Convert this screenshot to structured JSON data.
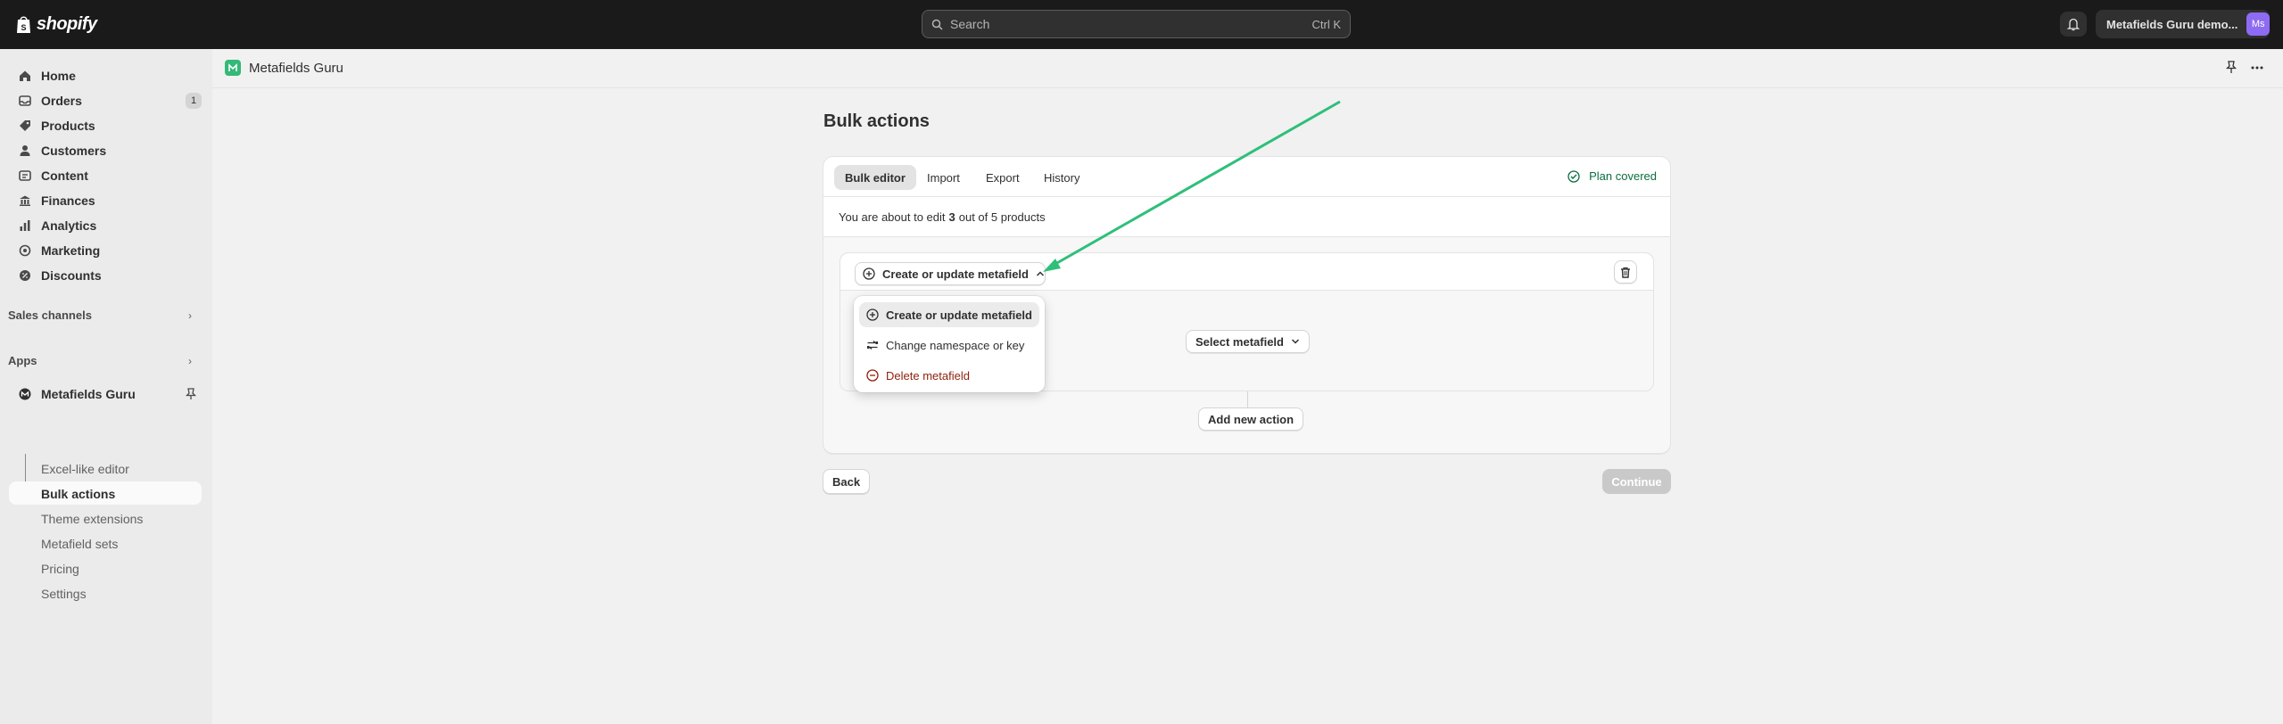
{
  "topbar": {
    "logo_text": "shopify",
    "search_placeholder": "Search",
    "search_shortcut": "Ctrl K",
    "store_name": "Metafields Guru demo...",
    "avatar_initials": "Ms"
  },
  "sidebar": {
    "items": [
      {
        "label": "Home",
        "icon": "home-icon"
      },
      {
        "label": "Orders",
        "icon": "orders-icon",
        "badge": "1"
      },
      {
        "label": "Products",
        "icon": "tag-icon"
      },
      {
        "label": "Customers",
        "icon": "person-icon"
      },
      {
        "label": "Content",
        "icon": "content-icon"
      },
      {
        "label": "Finances",
        "icon": "bank-icon"
      },
      {
        "label": "Analytics",
        "icon": "chart-icon"
      },
      {
        "label": "Marketing",
        "icon": "target-icon"
      },
      {
        "label": "Discounts",
        "icon": "discount-icon"
      }
    ],
    "sales_channels": "Sales channels",
    "apps": "Apps",
    "app_name": "Metafields Guru",
    "app_subitems": [
      "Excel-like editor",
      "Bulk actions",
      "Theme extensions",
      "Metafield sets",
      "Pricing",
      "Settings"
    ]
  },
  "main": {
    "app_title": "Metafields Guru",
    "page_title": "Bulk actions",
    "tabs": [
      "Bulk editor",
      "Import",
      "Export",
      "History"
    ],
    "plan_label": "Plan covered",
    "info_prefix": "You are about to edit",
    "info_count": "3",
    "info_suffix": "out of 5 products",
    "action_label": "Create or update metafield",
    "select_label": "Select metafield",
    "add_label": "Add new action",
    "dropdown": [
      "Create or update metafield",
      "Change namespace or key",
      "Delete metafield"
    ],
    "back_label": "Back",
    "continue_label": "Continue"
  },
  "colors": {
    "accent_green": "#2fbf7a",
    "danger": "#8e1f0b",
    "topbar": "#1a1a1a"
  }
}
